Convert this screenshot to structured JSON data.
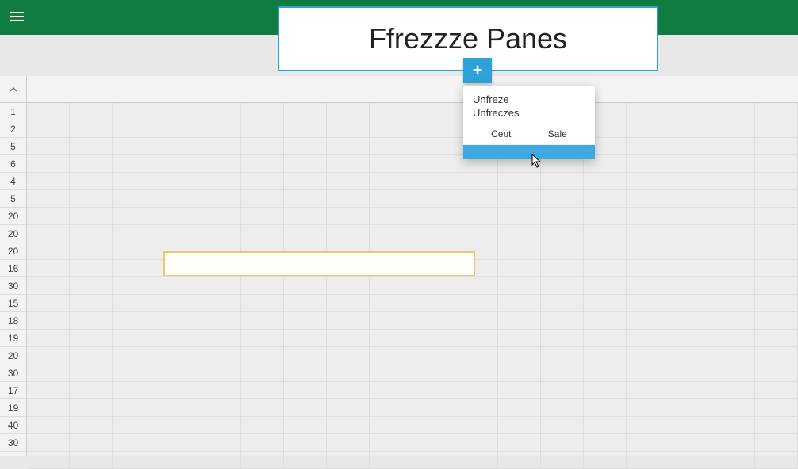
{
  "header": {
    "title": "Ffrezzze Panes"
  },
  "plus": {
    "label": "+"
  },
  "row_headers": [
    "1",
    "2",
    "5",
    "6",
    "4",
    "5",
    "20",
    "20",
    "20",
    "16",
    "30",
    "15",
    "18",
    "19",
    "20",
    "30",
    "17",
    "19",
    "40",
    "30"
  ],
  "dropdown": {
    "line1": "Unfreze",
    "line2": "Unfreczes",
    "action1": "Ceut",
    "action2": "Sale"
  },
  "colors": {
    "brand_green": "#107c41",
    "accent_blue": "#2ea3d8",
    "highlight_blue": "#3ea8e0",
    "selection_border": "#e8c870"
  }
}
